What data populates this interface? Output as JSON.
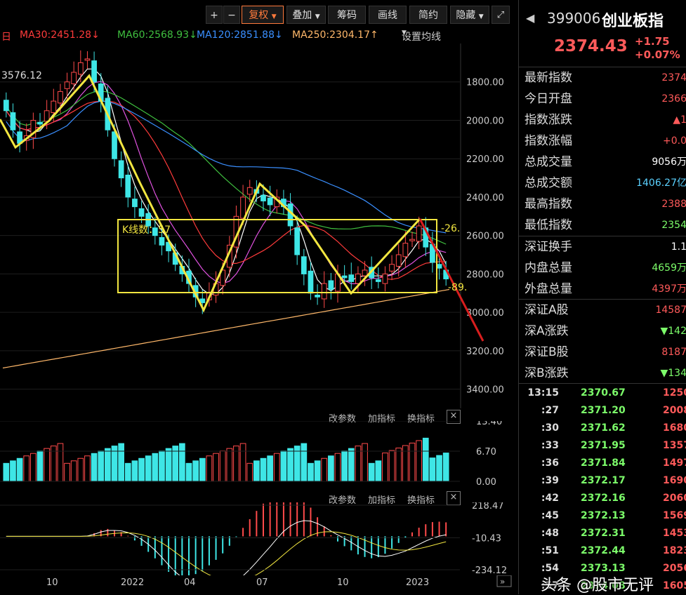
{
  "toolbar": {
    "plus": "+",
    "minus": "−",
    "fuquan": "复权",
    "diejia": "叠加",
    "chouma": "筹码",
    "huaxian": "画线",
    "jianyue": "简约",
    "yincang": "隐藏",
    "expand_icon": "expand-icon"
  },
  "ma": {
    "ma_prefix": "日",
    "ma30": "MA30:2451.28↓",
    "ma60": "MA60:2568.93↓",
    "ma120": "MA120:2851.88↓",
    "ma250": "MA250:2304.17↑",
    "settings": "设置均线",
    "colors": {
      "ma30": "#ff3b3b",
      "ma60": "#3fbf3f",
      "ma120": "#3a8fff",
      "ma250": "#ffb86a"
    }
  },
  "main_chart": {
    "high_label": "3576.12",
    "box_label": "K线数：57",
    "right_top_label": "-26.",
    "right_bottom_label": "-89.",
    "y_ticks": [
      "3400.00",
      "3200.00",
      "3000.00",
      "2800.00",
      "2600.00",
      "2400.00",
      "2200.00",
      "2000.00",
      "1800.00"
    ]
  },
  "volume_pane": {
    "btn_params": "改参数",
    "btn_add": "加指标",
    "btn_switch": "换指标",
    "close": "×",
    "y_ticks": [
      "13.40",
      "6.70",
      "0.00"
    ]
  },
  "macd_pane": {
    "btn_params": "改参数",
    "btn_add": "加指标",
    "btn_switch": "换指标",
    "close": "×",
    "y_ticks": [
      "218.47",
      "-10.43",
      "-234.12"
    ]
  },
  "x_axis": [
    "10",
    "2022",
    "04",
    "07",
    "10",
    "2023"
  ],
  "quote": {
    "code": "399006",
    "name": "创业板指",
    "price": "2374.43",
    "change": "+1.75",
    "change_pct": "+0.07%",
    "rows": [
      {
        "label": "最新指数",
        "value": "2374",
        "color": "#ff5a5a"
      },
      {
        "label": "今日开盘",
        "value": "2366",
        "color": "#ff5a5a"
      },
      {
        "label": "指数涨跌",
        "value": "▲1",
        "color": "#ff5a5a"
      },
      {
        "label": "指数涨幅",
        "value": "+0.0",
        "color": "#ff5a5a"
      },
      {
        "label": "总成交量",
        "value": "9056万",
        "color": "#ffffff"
      },
      {
        "label": "总成交额",
        "value": "1406.27亿",
        "color": "#5ad1ff"
      },
      {
        "label": "最高指数",
        "value": "2388",
        "color": "#ff5a5a"
      },
      {
        "label": "最低指数",
        "value": "2354",
        "color": "#7CFC6A"
      }
    ],
    "rows2": [
      {
        "label": "深证换手",
        "value": "1.1",
        "color": "#ffffff"
      },
      {
        "label": "内盘总量",
        "value": "4659万",
        "color": "#7CFC6A"
      },
      {
        "label": "外盘总量",
        "value": "4397万",
        "color": "#ff5a5a"
      }
    ],
    "rows3": [
      {
        "label": "深证A股",
        "value": "14587",
        "color": "#ff5a5a"
      },
      {
        "label": "深A涨跌",
        "value": "▼142",
        "color": "#7CFC6A"
      },
      {
        "label": "深证B股",
        "value": "8187",
        "color": "#ff5a5a"
      },
      {
        "label": "深B涨跌",
        "value": "▼134",
        "color": "#7CFC6A"
      }
    ],
    "ticks": [
      {
        "time": "13:15",
        "price": "2370.67",
        "vol": "1250"
      },
      {
        "time": ":27",
        "price": "2371.20",
        "vol": "2008"
      },
      {
        "time": ":30",
        "price": "2371.62",
        "vol": "1680"
      },
      {
        "time": ":33",
        "price": "2371.95",
        "vol": "1357"
      },
      {
        "time": ":36",
        "price": "2371.84",
        "vol": "1497"
      },
      {
        "time": ":39",
        "price": "2372.17",
        "vol": "1690"
      },
      {
        "time": ":42",
        "price": "2372.16",
        "vol": "2060"
      },
      {
        "time": ":45",
        "price": "2372.13",
        "vol": "1569"
      },
      {
        "time": ":48",
        "price": "2372.31",
        "vol": "1453"
      },
      {
        "time": ":51",
        "price": "2372.44",
        "vol": "1823"
      },
      {
        "time": ":54",
        "price": "2373.13",
        "vol": "2056"
      },
      {
        "time": ":57",
        "price": "2374.08",
        "vol": "1605"
      }
    ]
  },
  "watermark": "头条 @股市无评",
  "chart_data": {
    "type": "candlestick",
    "title": "",
    "ylim": [
      1700,
      3600
    ],
    "y_ticks": [
      1800,
      2000,
      2200,
      2400,
      2600,
      2800,
      3000,
      3200,
      3400
    ],
    "x_labels": [
      "10",
      "2022",
      "04",
      "07",
      "10",
      "2023"
    ],
    "weekly_closes": [
      3250,
      3150,
      3080,
      3120,
      3200,
      3180,
      3250,
      3300,
      3350,
      3400,
      3450,
      3500,
      3520,
      3400,
      3300,
      3150,
      3000,
      2900,
      2800,
      2750,
      2700,
      2650,
      2600,
      2550,
      2520,
      2450,
      2400,
      2350,
      2280,
      2250,
      2300,
      2350,
      2420,
      2550,
      2700,
      2800,
      2850,
      2820,
      2780,
      2760,
      2800,
      2750,
      2650,
      2500,
      2400,
      2300,
      2280,
      2350,
      2320,
      2400,
      2380,
      2360,
      2400,
      2420,
      2380,
      2360,
      2400,
      2450,
      2500,
      2560,
      2580,
      2650,
      2540,
      2460,
      2430,
      2374
    ],
    "annotations": {
      "peak_high": 3576.12,
      "box_range": [
        2240,
        2670
      ]
    }
  }
}
